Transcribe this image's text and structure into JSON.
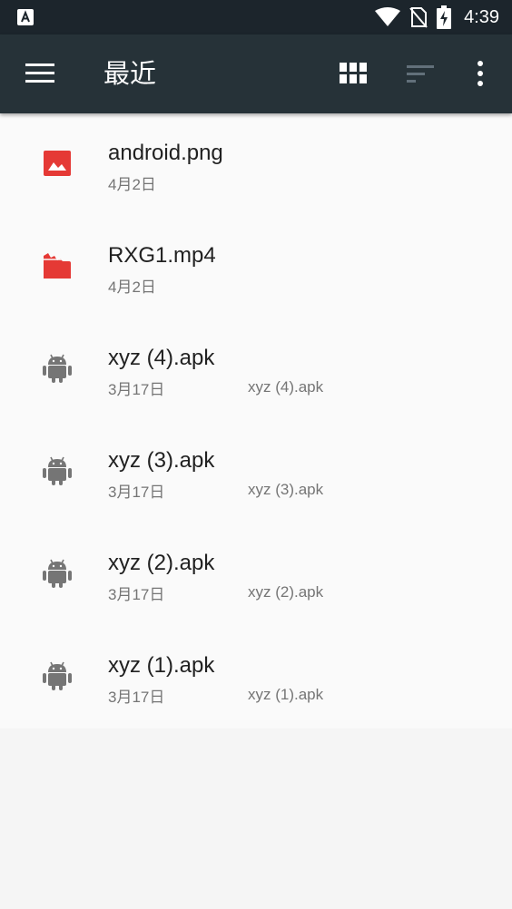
{
  "status_bar": {
    "time": "4:39",
    "icons": [
      "app-notification-icon",
      "wifi-icon",
      "no-sim-icon",
      "battery-charging-icon"
    ]
  },
  "app_bar": {
    "title": "最近",
    "colors": {
      "background": "#263238",
      "status_bar": "#1c252c"
    },
    "actions": [
      "menu-icon",
      "grid-view-icon",
      "sort-icon",
      "more-vert-icon"
    ]
  },
  "files": [
    {
      "name": "android.png",
      "date": "4月2日",
      "summary": "",
      "icon": "image-icon",
      "icon_color": "#e53935"
    },
    {
      "name": "RXG1.mp4",
      "date": "4月2日",
      "summary": "",
      "icon": "video-icon",
      "icon_color": "#e53935"
    },
    {
      "name": "xyz (4).apk",
      "date": "3月17日",
      "summary": "xyz (4).apk",
      "icon": "android-icon",
      "icon_color": "#757575"
    },
    {
      "name": "xyz (3).apk",
      "date": "3月17日",
      "summary": "xyz (3).apk",
      "icon": "android-icon",
      "icon_color": "#757575"
    },
    {
      "name": "xyz (2).apk",
      "date": "3月17日",
      "summary": "xyz (2).apk",
      "icon": "android-icon",
      "icon_color": "#757575"
    },
    {
      "name": "xyz (1).apk",
      "date": "3月17日",
      "summary": "xyz (1).apk",
      "icon": "android-icon",
      "icon_color": "#757575"
    }
  ]
}
